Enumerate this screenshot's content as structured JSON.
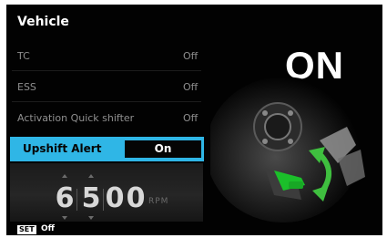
{
  "header": {
    "title": "Vehicle"
  },
  "menu": {
    "rows": [
      {
        "label": "TC",
        "value": "Off"
      },
      {
        "label": "ESS",
        "value": "Off"
      },
      {
        "label": "Activation Quick shifter",
        "value": "Off"
      }
    ],
    "selected": {
      "label": "Upshift Alert",
      "value": "On"
    }
  },
  "rpm": {
    "digits": [
      "6",
      "5",
      "0",
      "0"
    ],
    "unit": "RPM"
  },
  "footer": {
    "set_badge": "SET",
    "set_label": "Off"
  },
  "status": {
    "big_label": "ON"
  },
  "colors": {
    "accent": "#2fb6e6",
    "arrow": "#3fbf3f",
    "pedal": "#1bbf2a",
    "background": "#020202"
  }
}
